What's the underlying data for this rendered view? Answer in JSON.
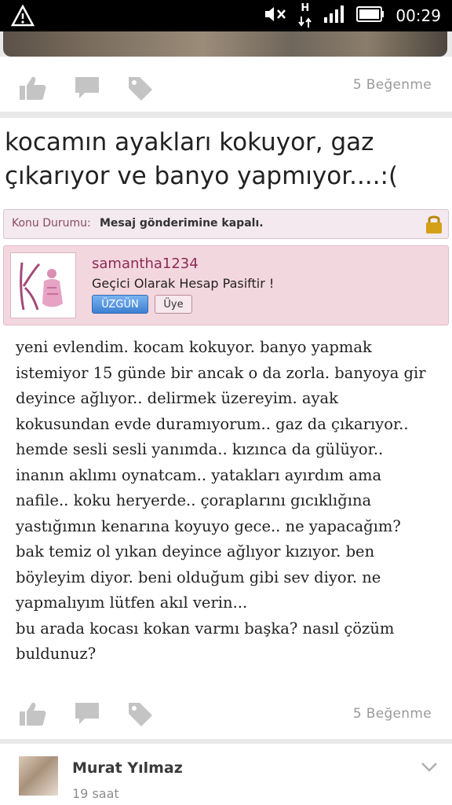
{
  "statusbar": {
    "time": "00:29",
    "network": "H"
  },
  "post": {
    "likes_top": "5 Beğenme",
    "title": "kocamın ayakları kokuyor, gaz çıkarıyor ve banyo yapmıyor....:(",
    "status_label": "Konu Durumu:",
    "status_value": "Mesaj gönderimine kapalı.",
    "username": "samantha1234",
    "user_status": "Geçici Olarak Hesap Pasiftir !",
    "mood_badge": "ÜZGÜN",
    "member_badge": "Üye",
    "body": "yeni evlendim. kocam kokuyor. banyo yapmak\nistemiyor 15 günde bir ancak o da zorla. banyoya gir\ndeyince ağlıyor.. delirmek üzereyim. ayak\nkokusundan evde duramıyorum.. gaz da çıkarıyor..\nhemde sesli sesli yanımda.. kızınca da gülüyor..\ninanın aklımı oynatcam.. yatakları ayırdım ama\nnafile.. koku heryerde.. çoraplarını gıcıklığına\nyastığımın kenarına koyuyo gece.. ne yapacağım?\nbak temiz ol yıkan deyince ağlıyor kızıyor. ben\nböyleyim diyor. beni olduğum gibi sev diyor. ne\nyapmalıyım lütfen akıl verin...\nbu arada kocası kokan varmı başka? nasıl çözüm\nbuldunuz?",
    "likes_bottom": "5 Beğenme"
  },
  "comment": {
    "author": "Murat Yılmaz",
    "time": "19 saat"
  },
  "icons": {
    "like": "thumbs-up-icon",
    "comment": "comment-icon",
    "tag": "tag-icon",
    "lock": "lock-icon",
    "chevron": "chevron-down-icon"
  },
  "colors": {
    "icon_gray": "#c4c4c4",
    "username": "#8e2a54",
    "mood_badge": "#3e7fd1",
    "user_box": "#f3d7df"
  }
}
